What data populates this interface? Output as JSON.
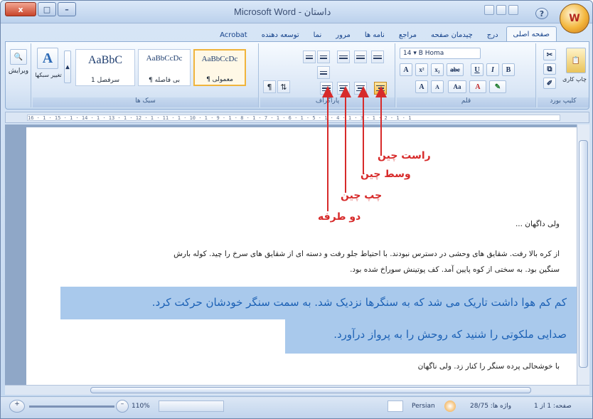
{
  "window": {
    "title": "Microsoft Word - داستان",
    "close": "x",
    "maximize": "□",
    "minimize": "–",
    "help": "?"
  },
  "tabs": [
    "صفحه اصلی",
    "درج",
    "چیدمان صفحه",
    "مراجع",
    "نامه ها",
    "مرور",
    "نما",
    "توسعه دهنده",
    "Acrobat"
  ],
  "ribbon": {
    "clipboard": {
      "label": "کلیپ بورد",
      "paste": "چاپ کاری"
    },
    "font": {
      "label": "قلم",
      "size": "14",
      "name": "B Homa",
      "bold": "B",
      "italic": "I",
      "underline": "U"
    },
    "paragraph": {
      "label": "پاراگراف"
    },
    "styles": {
      "label": "سبک ها",
      "items": [
        {
          "sample": "AaBbCcDc",
          "name": "¶ معمولی"
        },
        {
          "sample": "AaBbCcDc",
          "name": "¶ بی فاصله"
        },
        {
          "sample": "AaBbC",
          "name": "سرفصل 1"
        }
      ],
      "change": "تغییر سبکها"
    },
    "editing": {
      "label": "ویرایش"
    }
  },
  "ruler": "16 · 1 · 15 · 1 · 14 · 1 · 13 · 1 · 12 · 1 · 11 · 1 · 10 · 1 · 9 · 1 · 8 · 1 · 7 · 1 · 6 · 1 · 5 · 1 · 4 · 1 · 3 · 1 · 2 · 1 · 1",
  "annotations": {
    "right": "راست چین",
    "center": "وسط چین",
    "left": "چپ چین",
    "justify": "دو طرفه"
  },
  "document": {
    "line1": "ولی داگهان ...",
    "para1a": "از کره بالا رفت. شقایق های وحشی در دسترس نبودند. با احتیاط جلو رفت و دسته ای از شقایق های سرخ را چید. کوله بارش",
    "para1b": "سنگین بود. به سختی از کوه پایین آمد. کف پوتینش سوراخ شده بود.",
    "hl1": "کم کم هوا داشت تاریک می شد که به سنگرها نزدیک شد. به سمت سنگر خودشان حرکت کرد.",
    "hl2": "صدایی ملکوتی را شنید که روحش را به پرواز درآورد.",
    "last": "با خوشحالی پرده سنگر را کنار زد. ولی ناگهان"
  },
  "status": {
    "page": "صفحه: 1 از 1",
    "words": "واژه ها: 28/75",
    "lang": "Persian",
    "zoom": "110%"
  },
  "colors": {
    "annotation": "#d72a2a",
    "highlight": "#a9c9ec",
    "highlightText": "#1c61b5"
  }
}
